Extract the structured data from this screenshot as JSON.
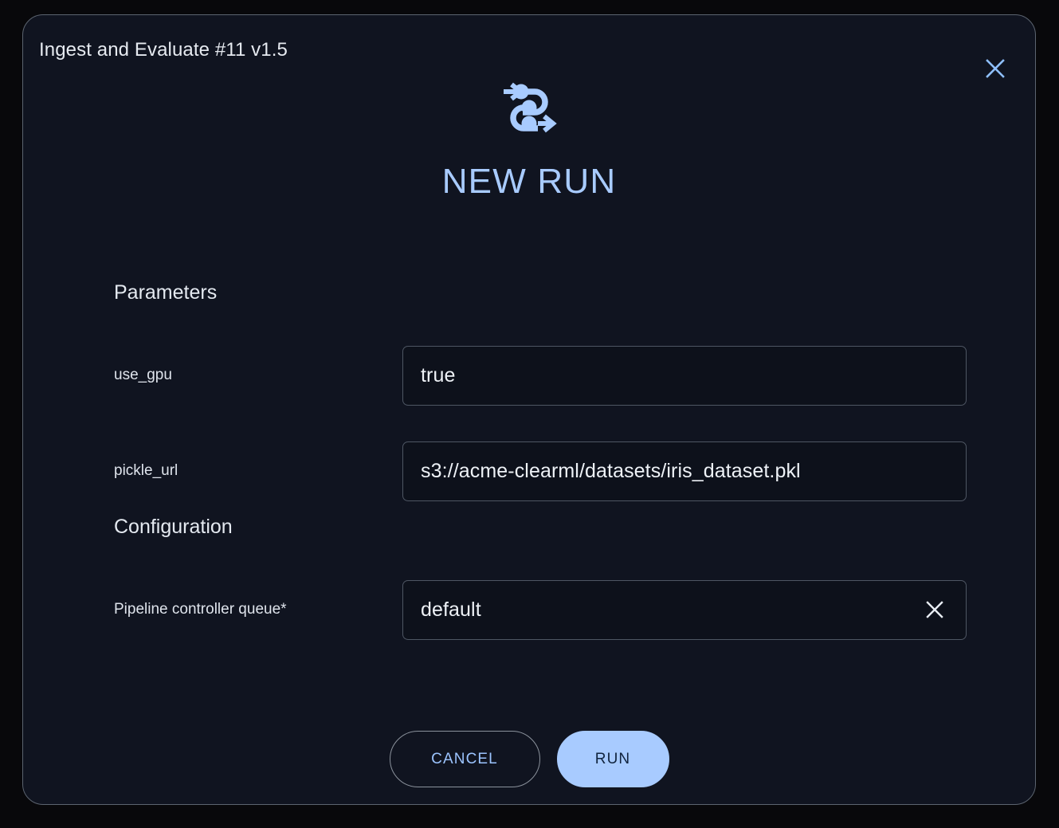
{
  "dialog": {
    "title": "Ingest and Evaluate #11 v1.5",
    "close_icon": "close-icon",
    "hero_icon": "pipeline-icon",
    "hero_title": "NEW RUN",
    "accent_color": "#a8cbff",
    "surface_color": "#101420",
    "border_color": "#5c6470"
  },
  "sections": [
    {
      "heading": "Parameters",
      "fields": [
        {
          "label": "use_gpu",
          "value": "true",
          "clearable": false
        },
        {
          "label": "pickle_url",
          "value": "s3://acme-clearml/datasets/iris_dataset.pkl",
          "clearable": false
        }
      ]
    },
    {
      "heading": "Configuration",
      "fields": [
        {
          "label": "Pipeline controller queue*",
          "value": "default",
          "clearable": true,
          "clear_icon": "clear-icon"
        }
      ]
    }
  ],
  "footer": {
    "cancel_label": "CANCEL",
    "run_label": "RUN"
  }
}
